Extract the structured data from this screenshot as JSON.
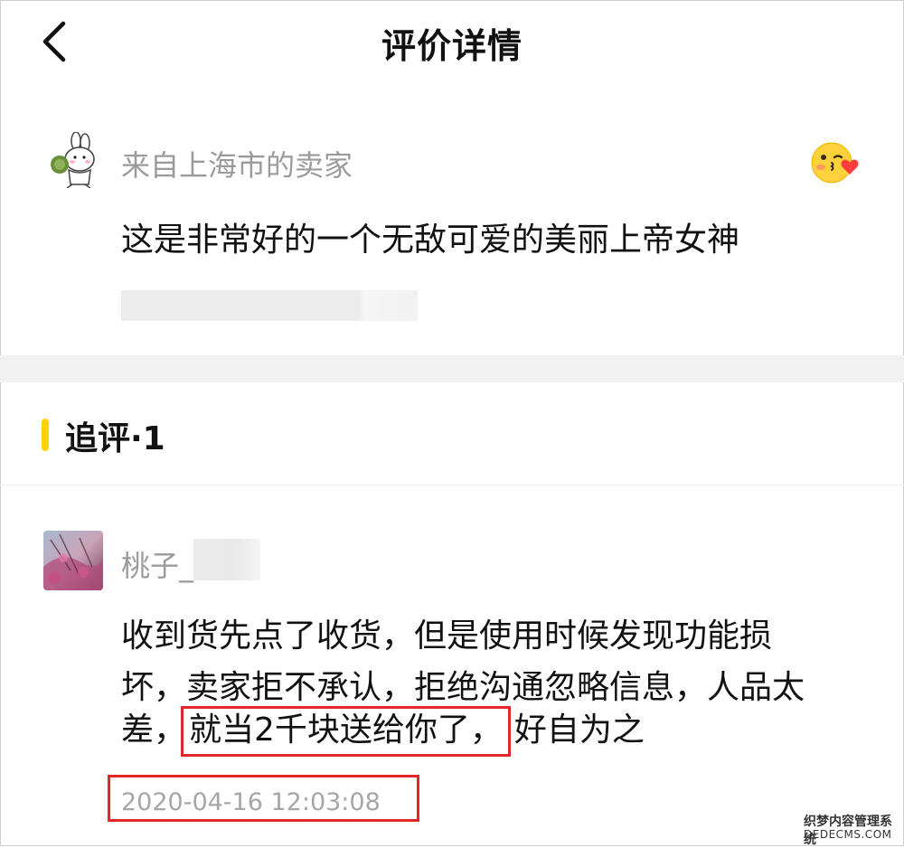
{
  "header": {
    "title": "评价详情",
    "back_icon": "chevron-left-icon"
  },
  "seller_review": {
    "author": "来自上海市的卖家",
    "text": "这是非常好的一个无敌可爱的美丽上帝女神",
    "avatar_icon": "bunny-avatar-icon",
    "reaction_icon": "kiss-heart-emoji-icon"
  },
  "follow_up": {
    "section_title": "追评·1",
    "user_name": "桃子_",
    "text_line1": "收到货先点了收货，但是使用时候发现功能损",
    "text_line2": "坏，卖家拒不承认，拒绝沟通忽略信息，人品太",
    "text_line3_prefix": "差，",
    "text_line3_highlight": "就当2千块送给你了，",
    "text_line3_suffix": "好自为之",
    "timestamp": "2020-04-16 12:03:08"
  },
  "watermark": {
    "line1": "织梦内容管理系统",
    "line2": "DEDECMS.COM"
  },
  "colors": {
    "accent_yellow": "#ffd200",
    "highlight_red": "#e3262b",
    "muted_text": "#9b9b9b"
  }
}
